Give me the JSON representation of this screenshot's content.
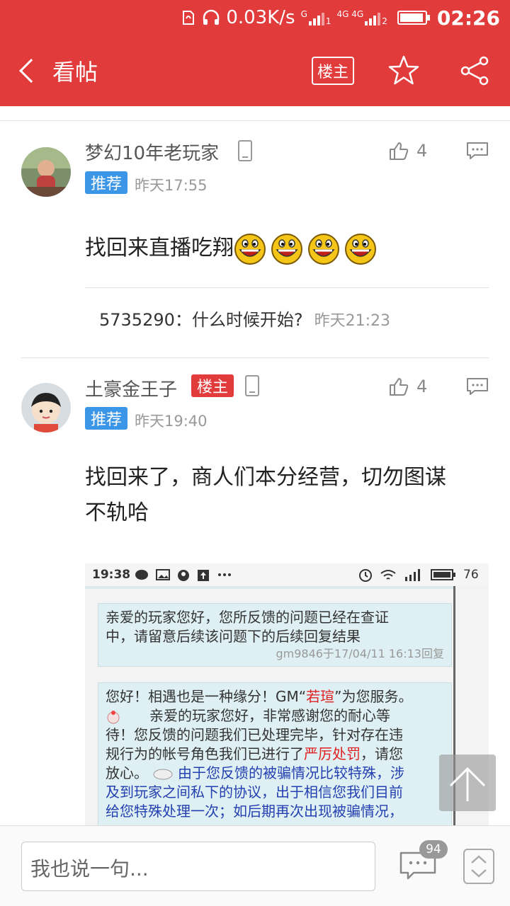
{
  "status_bar": {
    "speed": "0.03K/s",
    "sim1_label": "G",
    "sim1_slot": "1",
    "sim2_label": "4G 4G",
    "sim2_slot": "2",
    "time": "02:26"
  },
  "header": {
    "title": "看帖",
    "louzhu_label": "楼主",
    "accent_color": "#e23b3b"
  },
  "posts": [
    {
      "username": "梦幻10年老玩家",
      "recommend_label": "推荐",
      "time": "昨天17:55",
      "likes": "4",
      "content": "找回来直播吃翔",
      "emoji_count": 4,
      "sub_reply": {
        "author": "5735290",
        "separator": "：",
        "text": "什么时候开始?",
        "time": "昨天21:23"
      }
    },
    {
      "username": "土豪金王子",
      "louzhu_badge": "楼主",
      "recommend_label": "推荐",
      "time": "昨天19:40",
      "likes": "4",
      "content_line1": "找回来了，商人们本分经营，切勿图谋",
      "content_line2": "不轨哈",
      "screenshot": {
        "time": "19:38",
        "right_status": "76",
        "message1": {
          "line1": "亲爱的玩家您好，您所反馈的问题已经在查证",
          "line2": "中，请留意后续该问题下的后续回复结果",
          "footer": "gm9846于17/04/11 16:13回复"
        },
        "message2": {
          "line1_prefix": "您好！相遇也是一种缘分！GM“",
          "gm_name": "若瑄",
          "line1_suffix": "”为您服务。",
          "line2": "亲爱的玩家您好，非常感谢您的耐心等",
          "line3": "待！您反馈的问题我们已处理完毕，针对存在违",
          "line4_prefix": "规行为的帐号角色我们已进行了",
          "penalty": "严厉处罚",
          "line4_suffix": "，请您",
          "line5_prefix": "放心。",
          "line5_blue": "由于您反馈的被骗情况比较特殊，涉",
          "line6": "及到玩家之间私下的协议，出于相信您我们目前",
          "line7": "给您特殊处理一次；如后期再次出现被骗情况，"
        }
      }
    }
  ],
  "bottom_bar": {
    "input_placeholder": "我也说一句...",
    "comment_count": "94"
  }
}
